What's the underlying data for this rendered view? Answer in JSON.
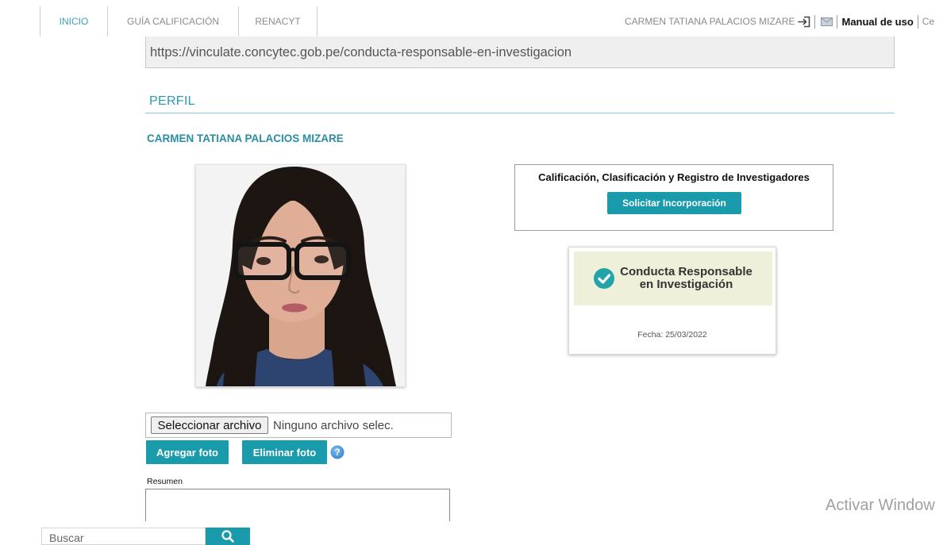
{
  "nav": {
    "tabs": [
      {
        "label": "INICIO",
        "active": true
      },
      {
        "label": "GUÍA CALIFICACIÓN",
        "active": false
      },
      {
        "label": "RENACYT",
        "active": false
      }
    ],
    "user_name": "CARMEN TATIANA PALACIOS MIZARE",
    "logout_icon": "logout-icon",
    "mail_icon": "envelope-icon",
    "manual_label": "Manual de uso",
    "truncated_label": "Ce"
  },
  "notice": {
    "url": "https://vinculate.concytec.gob.pe/conducta-responsable-en-investigacion"
  },
  "profile": {
    "section_title": "PERFIL",
    "full_name": "CARMEN TATIANA PALACIOS MIZARE"
  },
  "registry": {
    "title": "Calificación, Clasificación y Registro de Investigadores",
    "button_label": "Solicitar Incorporación"
  },
  "badge": {
    "icon": "check-circle-icon",
    "line1": "Conducta Responsable",
    "line2": "en Investigación",
    "date": "Fecha: 25/03/2022"
  },
  "upload": {
    "choose_label": "Seleccionar archivo",
    "status": "Ninguno archivo selec.",
    "add_label": "Agregar foto",
    "remove_label": "Eliminar foto",
    "help_icon": "help-icon",
    "help_glyph": "?"
  },
  "summary": {
    "label": "Resumen",
    "value": ""
  },
  "watermark": {
    "text": "Activar Window"
  },
  "search": {
    "placeholder": "Buscar",
    "icon": "search-icon"
  },
  "colors": {
    "accent": "#1a9bab",
    "heading": "#2b9bb4",
    "name": "#2a8ea3",
    "tab_active": "#3a9fbf",
    "badge_bg": "#eef0d9",
    "help": "#4a9ae0"
  }
}
